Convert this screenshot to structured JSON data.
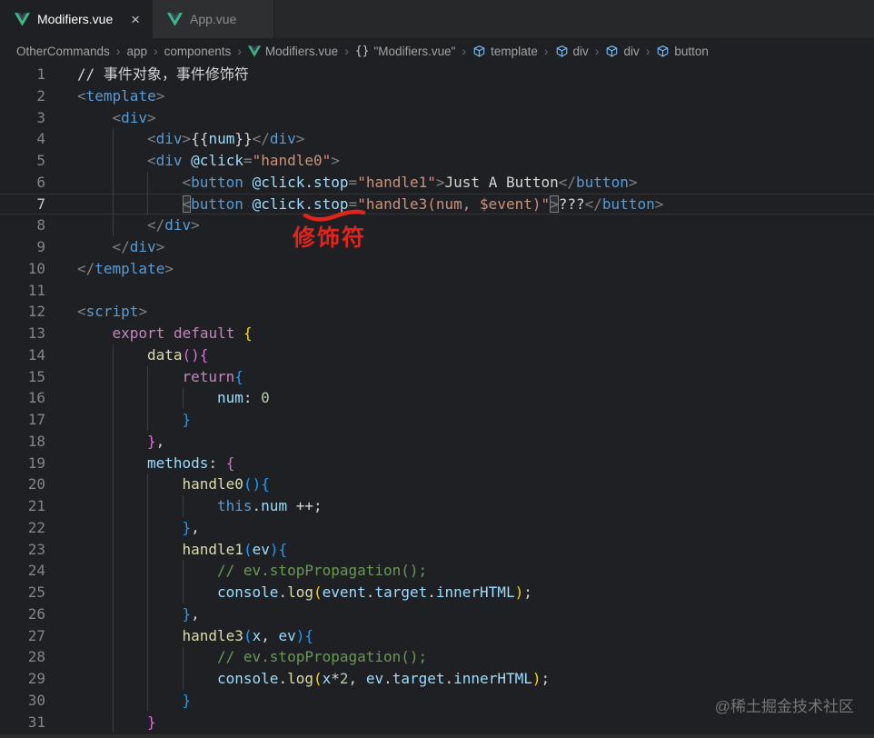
{
  "tabs": [
    {
      "label": "Modifiers.vue",
      "state": "active",
      "close_label": "×",
      "icon": "vue-logo"
    },
    {
      "label": "App.vue",
      "state": "inactive",
      "icon": "vue-logo"
    }
  ],
  "breadcrumb": {
    "separator": "›",
    "items": [
      {
        "label": "OtherCommands"
      },
      {
        "label": "app"
      },
      {
        "label": "components"
      },
      {
        "icon": "vue",
        "label": "Modifiers.vue"
      },
      {
        "icon": "braces",
        "label": "\"Modifiers.vue\""
      },
      {
        "icon": "cube",
        "label": "template"
      },
      {
        "icon": "cube",
        "label": "div"
      },
      {
        "icon": "cube",
        "label": "div"
      },
      {
        "icon": "cube",
        "label": "button"
      }
    ]
  },
  "editor": {
    "lines": [
      {
        "n": 1,
        "ind": 0,
        "segs": [
          [
            "// 事件对象，事件修饰符",
            "fg"
          ]
        ]
      },
      {
        "n": 2,
        "ind": 0,
        "segs": [
          [
            "<",
            "p"
          ],
          [
            "template",
            "tag"
          ],
          [
            ">",
            "p"
          ]
        ]
      },
      {
        "n": 3,
        "ind": 1,
        "segs": [
          [
            "<",
            "p"
          ],
          [
            "div",
            "tag"
          ],
          [
            ">",
            "p"
          ]
        ]
      },
      {
        "n": 4,
        "ind": 2,
        "segs": [
          [
            "<",
            "p"
          ],
          [
            "div",
            "tag"
          ],
          [
            ">",
            "p"
          ],
          [
            "{{",
            "fg"
          ],
          [
            "num",
            "attr"
          ],
          [
            "}}",
            "fg"
          ],
          [
            "</",
            "p"
          ],
          [
            "div",
            "tag"
          ],
          [
            ">",
            "p"
          ]
        ]
      },
      {
        "n": 5,
        "ind": 2,
        "segs": [
          [
            "<",
            "p"
          ],
          [
            "div ",
            "tag"
          ],
          [
            "@click",
            "attr"
          ],
          [
            "=",
            "p"
          ],
          [
            "\"handle0\"",
            "str"
          ],
          [
            ">",
            "p"
          ]
        ]
      },
      {
        "n": 6,
        "ind": 3,
        "segs": [
          [
            "<",
            "p"
          ],
          [
            "button ",
            "tag"
          ],
          [
            "@click.stop",
            "attr"
          ],
          [
            "=",
            "p"
          ],
          [
            "\"handle1\"",
            "str"
          ],
          [
            ">",
            "p"
          ],
          [
            "Just A Button",
            "fg"
          ],
          [
            "</",
            "p"
          ],
          [
            "button",
            "tag"
          ],
          [
            ">",
            "p"
          ]
        ]
      },
      {
        "n": 7,
        "ind": 3,
        "cur": true,
        "segs": [
          [
            "<",
            "p",
            "box"
          ],
          [
            "button ",
            "tag"
          ],
          [
            "@click.stop",
            "attr"
          ],
          [
            "=",
            "p"
          ],
          [
            "\"handle3(num, $event)\"",
            "str"
          ],
          [
            ">",
            "p",
            "box"
          ],
          [
            "???",
            "fg"
          ],
          [
            "</",
            "p"
          ],
          [
            "button",
            "tag"
          ],
          [
            ">",
            "p"
          ]
        ]
      },
      {
        "n": 8,
        "ind": 2,
        "segs": [
          [
            "</",
            "p"
          ],
          [
            "div",
            "tag"
          ],
          [
            ">",
            "p"
          ]
        ]
      },
      {
        "n": 9,
        "ind": 1,
        "segs": [
          [
            "</",
            "p"
          ],
          [
            "div",
            "tag"
          ],
          [
            ">",
            "p"
          ]
        ]
      },
      {
        "n": 10,
        "ind": 0,
        "segs": [
          [
            "</",
            "p"
          ],
          [
            "template",
            "tag"
          ],
          [
            ">",
            "p"
          ]
        ]
      },
      {
        "n": 11,
        "ind": 0,
        "segs": []
      },
      {
        "n": 12,
        "ind": 0,
        "segs": [
          [
            "<",
            "p"
          ],
          [
            "script",
            "tag"
          ],
          [
            ">",
            "p"
          ]
        ]
      },
      {
        "n": 13,
        "ind": 1,
        "segs": [
          [
            "export",
            "kw"
          ],
          [
            " ",
            "fg"
          ],
          [
            "default",
            "kw"
          ],
          [
            " ",
            "fg"
          ],
          [
            "{",
            "b1"
          ]
        ]
      },
      {
        "n": 14,
        "ind": 2,
        "segs": [
          [
            "data",
            "fn"
          ],
          [
            "(){",
            "b2"
          ]
        ]
      },
      {
        "n": 15,
        "ind": 3,
        "segs": [
          [
            "return",
            "kw"
          ],
          [
            "{",
            "b3"
          ]
        ]
      },
      {
        "n": 16,
        "ind": 4,
        "segs": [
          [
            "num",
            "attr"
          ],
          [
            ": ",
            "fg"
          ],
          [
            "0",
            "num"
          ]
        ]
      },
      {
        "n": 17,
        "ind": 3,
        "segs": [
          [
            "}",
            "b3"
          ]
        ]
      },
      {
        "n": 18,
        "ind": 2,
        "segs": [
          [
            "}",
            "b2"
          ],
          [
            ",",
            "fg"
          ]
        ]
      },
      {
        "n": 19,
        "ind": 2,
        "segs": [
          [
            "methods",
            "attr"
          ],
          [
            ": ",
            "fg"
          ],
          [
            "{",
            "b2"
          ]
        ]
      },
      {
        "n": 20,
        "ind": 3,
        "segs": [
          [
            "handle0",
            "fn"
          ],
          [
            "(){",
            "b3"
          ]
        ]
      },
      {
        "n": 21,
        "ind": 4,
        "segs": [
          [
            "this",
            "kw2"
          ],
          [
            ".",
            "fg"
          ],
          [
            "num",
            "attr"
          ],
          [
            " ++;",
            "fg"
          ]
        ]
      },
      {
        "n": 22,
        "ind": 3,
        "segs": [
          [
            "}",
            "b3"
          ],
          [
            ",",
            "fg"
          ]
        ]
      },
      {
        "n": 23,
        "ind": 3,
        "segs": [
          [
            "handle1",
            "fn"
          ],
          [
            "(",
            "b3"
          ],
          [
            "ev",
            "attr"
          ],
          [
            "){",
            "b3"
          ]
        ]
      },
      {
        "n": 24,
        "ind": 4,
        "segs": [
          [
            "// ev.stopPropagation();",
            "cmt"
          ]
        ]
      },
      {
        "n": 25,
        "ind": 4,
        "segs": [
          [
            "console",
            "attr"
          ],
          [
            ".",
            "fg"
          ],
          [
            "log",
            "fn"
          ],
          [
            "(",
            "b1"
          ],
          [
            "event",
            "attr"
          ],
          [
            ".",
            "fg"
          ],
          [
            "target",
            "attr"
          ],
          [
            ".",
            "fg"
          ],
          [
            "innerHTML",
            "attr"
          ],
          [
            ")",
            "b1"
          ],
          [
            ";",
            "fg"
          ]
        ]
      },
      {
        "n": 26,
        "ind": 3,
        "segs": [
          [
            "}",
            "b3"
          ],
          [
            ",",
            "fg"
          ]
        ]
      },
      {
        "n": 27,
        "ind": 3,
        "segs": [
          [
            "handle3",
            "fn"
          ],
          [
            "(",
            "b3"
          ],
          [
            "x",
            "attr"
          ],
          [
            ", ",
            "fg"
          ],
          [
            "ev",
            "attr"
          ],
          [
            "){",
            "b3"
          ]
        ]
      },
      {
        "n": 28,
        "ind": 4,
        "segs": [
          [
            "// ev.stopPropagation();",
            "cmt"
          ]
        ]
      },
      {
        "n": 29,
        "ind": 4,
        "segs": [
          [
            "console",
            "attr"
          ],
          [
            ".",
            "fg"
          ],
          [
            "log",
            "fn"
          ],
          [
            "(",
            "b1"
          ],
          [
            "x",
            "attr"
          ],
          [
            "*",
            "fg"
          ],
          [
            "2",
            "num"
          ],
          [
            ", ",
            "fg"
          ],
          [
            "ev",
            "attr"
          ],
          [
            ".",
            "fg"
          ],
          [
            "target",
            "attr"
          ],
          [
            ".",
            "fg"
          ],
          [
            "innerHTML",
            "attr"
          ],
          [
            ")",
            "b1"
          ],
          [
            ";",
            "fg"
          ]
        ]
      },
      {
        "n": 30,
        "ind": 3,
        "segs": [
          [
            "}",
            "b3"
          ]
        ]
      },
      {
        "n": 31,
        "ind": 2,
        "segs": [
          [
            "}",
            "b2"
          ]
        ]
      }
    ]
  },
  "annotation": {
    "label": "修饰符",
    "color": "#e3241d",
    "target_token": "stop"
  },
  "watermark": "@稀土掘金技术社区",
  "colors": {
    "syntax": {
      "p": "#808080",
      "tag": "#569CD6",
      "attr": "#9CDCFE",
      "str": "#CE9178",
      "fg": "#D4D4D4",
      "kw": "#C586C0",
      "kw2": "#569CD6",
      "fn": "#DCDCAA",
      "num": "#B5CEA8",
      "cmt": "#6A9955",
      "b1": "#FFD700",
      "b2": "#DA70D6",
      "b3": "#179FFF"
    },
    "ui": {
      "editor_bg": "#1f2023",
      "tabbar_bg": "#27282a",
      "tab_inactive_bg": "#2e2f31",
      "tab_active_text": "#ffffff",
      "tab_inactive_text": "#8c8c8c",
      "breadcrumb_text": "#a3a3a3",
      "line_number": "#858585",
      "vue_green": "#41B883",
      "vue_dark": "#35495E",
      "symbol_blue": "#75BEFF",
      "annotation_red": "#e3241d",
      "watermark": "#767676"
    }
  }
}
